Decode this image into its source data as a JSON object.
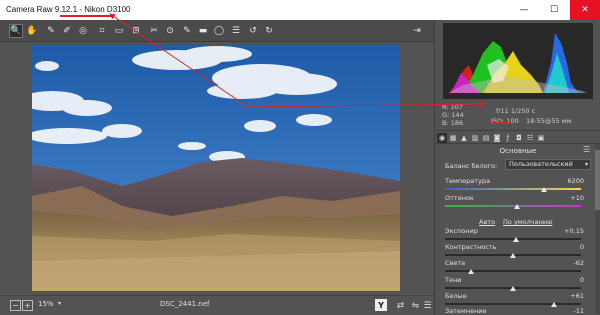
{
  "window": {
    "title": "Camera Raw 9.12.1  -  Nikon D3100",
    "minimize": "—",
    "maximize": "☐",
    "close": "✕"
  },
  "toolbar": {
    "tools": [
      {
        "icon": "zoom-icon",
        "glyph": "🔍"
      },
      {
        "icon": "hand-icon",
        "glyph": "✋"
      },
      {
        "icon": "white-balance-icon",
        "glyph": "✎"
      },
      {
        "icon": "color-sampler-icon",
        "glyph": "✐"
      },
      {
        "icon": "targeted-adjustment-icon",
        "glyph": "◎"
      },
      {
        "icon": "crop-icon",
        "glyph": "⌗"
      },
      {
        "icon": "straighten-icon",
        "glyph": "▭"
      },
      {
        "icon": "transform-icon",
        "glyph": "⊞"
      },
      {
        "icon": "spot-removal-icon",
        "glyph": "✂"
      },
      {
        "icon": "red-eye-icon",
        "glyph": "⊙"
      },
      {
        "icon": "adjustment-brush-icon",
        "glyph": "✎"
      },
      {
        "icon": "graduated-filter-icon",
        "glyph": "▬"
      },
      {
        "icon": "radial-filter-icon",
        "glyph": "◯"
      },
      {
        "icon": "preferences-icon",
        "glyph": "☰"
      },
      {
        "icon": "rotate-left-icon",
        "glyph": "↺"
      },
      {
        "icon": "rotate-right-icon",
        "glyph": "↻"
      }
    ],
    "export": "⇥"
  },
  "histogram": {
    "r": "R:   107",
    "g": "G:   144",
    "b": "B:   186",
    "aperture_shutter": "f/11     1/250 с",
    "iso": "ISO: 100",
    "lens": "18-55@55 мм"
  },
  "panel": {
    "section_title": "Основные",
    "white_balance_label": "Баланс белого:",
    "white_balance_value": "Пользовательский",
    "auto": "Авто",
    "default": "По умолчанию",
    "sliders": [
      {
        "label": "Температура",
        "value": "6200",
        "position": 0.8
      },
      {
        "label": "Оттенок",
        "value": "+10",
        "position": 0.53
      },
      {
        "label": "Экспонир",
        "value": "+0,15",
        "position": 0.52
      },
      {
        "label": "Контрастность",
        "value": "0",
        "position": 0.5
      },
      {
        "label": "Света",
        "value": "-62",
        "position": 0.19
      },
      {
        "label": "Тени",
        "value": "0",
        "position": 0.5
      },
      {
        "label": "Белые",
        "value": "+61",
        "position": 0.8
      },
      {
        "label": "Затемнение",
        "value": "-11",
        "position": 0.45
      }
    ]
  },
  "status": {
    "zoom": "15%",
    "filename": "DSC_2441.nef"
  },
  "colors": {
    "annotation": "#d8232a",
    "panel_bg": "#535353"
  }
}
